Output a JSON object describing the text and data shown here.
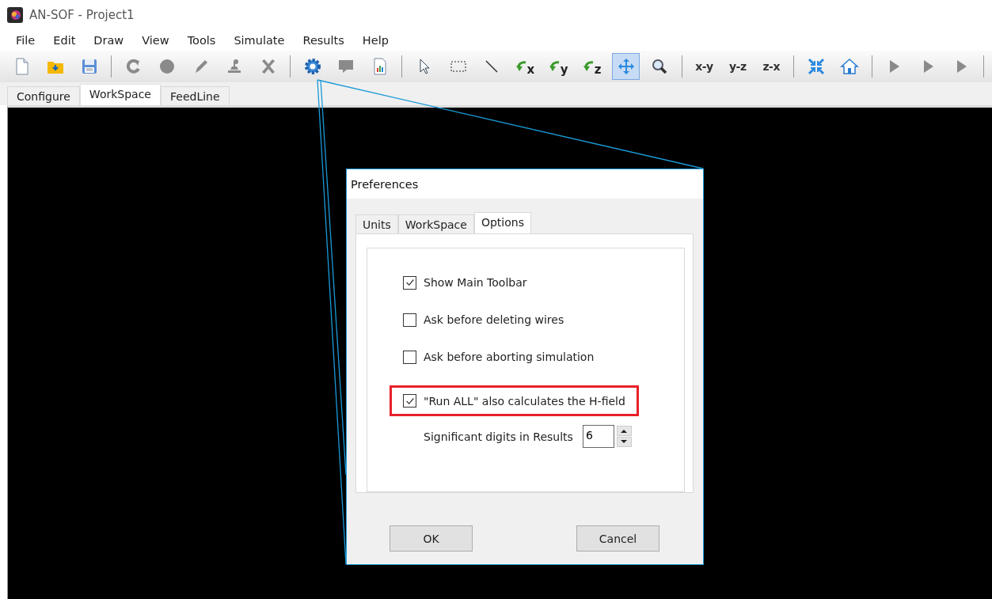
{
  "window": {
    "title": "AN-SOF - Project1"
  },
  "menu": [
    "File",
    "Edit",
    "Draw",
    "View",
    "Tools",
    "Simulate",
    "Results",
    "Help"
  ],
  "toolbar": [
    {
      "kind": "new-file",
      "selected": false
    },
    {
      "kind": "open-folder",
      "selected": false
    },
    {
      "kind": "save",
      "selected": false
    },
    {
      "kind": "separator"
    },
    {
      "kind": "undo",
      "selected": false
    },
    {
      "kind": "circle",
      "selected": false
    },
    {
      "kind": "pencil",
      "selected": false
    },
    {
      "kind": "stamp",
      "selected": false
    },
    {
      "kind": "delete",
      "selected": false
    },
    {
      "kind": "separator"
    },
    {
      "kind": "settings",
      "selected": false
    },
    {
      "kind": "comment",
      "selected": false
    },
    {
      "kind": "report",
      "selected": false
    },
    {
      "kind": "separator"
    },
    {
      "kind": "pointer",
      "selected": false
    },
    {
      "kind": "select-box",
      "selected": false
    },
    {
      "kind": "line",
      "selected": false
    },
    {
      "kind": "rotate",
      "label": "x",
      "selected": false
    },
    {
      "kind": "rotate",
      "label": "y",
      "selected": false
    },
    {
      "kind": "rotate",
      "label": "z",
      "selected": false
    },
    {
      "kind": "pan",
      "selected": true
    },
    {
      "kind": "zoom",
      "selected": false
    },
    {
      "kind": "separator"
    },
    {
      "kind": "text",
      "label": "x-y",
      "selected": false
    },
    {
      "kind": "text",
      "label": "y-z",
      "selected": false
    },
    {
      "kind": "text",
      "label": "z-x",
      "selected": false
    },
    {
      "kind": "separator"
    },
    {
      "kind": "fit",
      "selected": false
    },
    {
      "kind": "home",
      "selected": false
    },
    {
      "kind": "separator"
    },
    {
      "kind": "play",
      "selected": false
    },
    {
      "kind": "play",
      "selected": false
    },
    {
      "kind": "play",
      "selected": false
    },
    {
      "kind": "separator"
    }
  ],
  "tabs": [
    {
      "label": "Configure",
      "selected": false
    },
    {
      "label": "WorkSpace",
      "selected": true
    },
    {
      "label": "FeedLine",
      "selected": false
    }
  ],
  "dialog": {
    "title": "Preferences",
    "tabs": [
      {
        "label": "Units",
        "selected": false
      },
      {
        "label": "WorkSpace",
        "selected": false
      },
      {
        "label": "Options",
        "selected": true
      }
    ],
    "options": [
      {
        "kind": "checkbox",
        "label": "Show Main Toolbar",
        "checked": true,
        "highlighted": false
      },
      {
        "kind": "checkbox",
        "label": "Ask before deleting wires",
        "checked": false,
        "highlighted": false
      },
      {
        "kind": "checkbox",
        "label": "Ask before aborting simulation",
        "checked": false,
        "highlighted": false
      },
      {
        "kind": "checkbox",
        "label": "\"Run ALL\" also calculates the H-field",
        "checked": true,
        "highlighted": true
      },
      {
        "kind": "spinner",
        "label": "Significant digits in Results",
        "value": "6",
        "highlighted": false
      }
    ],
    "buttons": [
      "OK",
      "Cancel"
    ]
  }
}
